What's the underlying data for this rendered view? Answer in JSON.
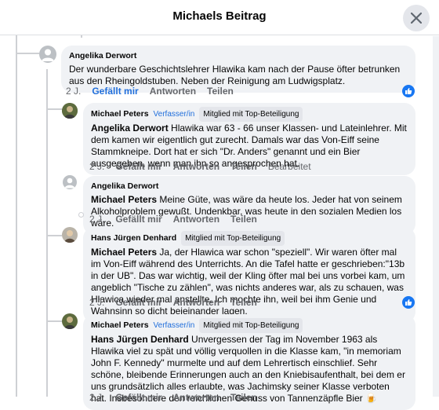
{
  "header": {
    "title": "Michaels Beitrag"
  },
  "comments": [
    {
      "author": "Angelika Derwort",
      "text": "Der wunderbare Geschichtslehrer Hlawika kam nach der Pause öfter betrunken aus den Rheingoldstuben. Neben der Reinigung am Ludwigsplatz.",
      "time": "2 J.",
      "like": "Gefällt mir",
      "reply": "Antworten",
      "share": "Teilen"
    },
    {
      "author": "Michael Peters",
      "badge_author": "Verfasser/in",
      "badge_top": "Mitglied mit Top-Beteiligung",
      "mention": "Angelika Derwort",
      "text": " Hlawika war 63 - 66 unser Klassen- und Lateinlehrer. Mit dem kamen wir eigentlich gut zurecht. Damals war das Von-Eiff seine Stammkneipe. Dort hat er sich \"Dr. Anders\" genannt und ein Bier ausgegeben, wenn man ihn so angesprochen hat.",
      "time": "2 J.",
      "like": "Gefällt mir",
      "reply": "Antworten",
      "share": "Teilen",
      "edited": "Bearbeitet"
    },
    {
      "author": "Angelika Derwort",
      "mention": "Michael Peters",
      "text": " Meine Güte, was wäre da heute los. Jeder hat von seinem Alkoholproblem gewußt. Undenkbar, was heute in den sozialen Medien los wäre.",
      "time": "2 J.",
      "like": "Gefällt mir",
      "reply": "Antworten",
      "share": "Teilen"
    },
    {
      "author": "Hans Jürgen Denhard",
      "badge_top": "Mitglied mit Top-Beteiligung",
      "mention": "Michael Peters",
      "text": " Ja, der Hlawica war schon \"speziell\". Wir waren öfter mal im Von-Eiff während des Unterrichts. An die Tafel hatte er geschrieben:\"13b in der UB\". Das war wichtig, weil der Kling öfter mal bei uns vorbei kam, um angeblich \"Tische zu zählen\", was nichts anderes war, als zu schauen, was Hlawica wieder mal anstellte. Ich mochte ihn, weil bei ihm Genie und Wahnsinn so dicht beieinander lagen.",
      "time": "2 J.",
      "like": "Gefällt mir",
      "reply": "Antworten",
      "share": "Teilen"
    },
    {
      "author": "Michael Peters",
      "badge_author": "Verfasser/in",
      "badge_top": "Mitglied mit Top-Beteiligung",
      "mention": "Hans Jürgen Denhard",
      "text": " Unvergessen der Tag im November 1963 als Hlawika viel zu spät und völlig verquollen in die Klasse kam, \"in memoriam John F. Kennedy\" murmelte und auf dem Lehrertisch einschlief. Sehr schöne, bleibende Erinnerungen auch an den Kniebisaufenthalt, bei dem er uns grundsätzlich alles erlaubte, was Jachimsky seiner Klasse verboten hat. Insbesondere den reichlichen Genuss von Tannenzäpfle Bier",
      "emoji": "🍺",
      "time": "2 J.",
      "like": "Gefällt mir",
      "reply": "Antworten",
      "share": "Teilen"
    }
  ],
  "colors": {
    "accent": "#216fdb",
    "bubble": "#f0f2f5",
    "meta": "#65676b"
  }
}
